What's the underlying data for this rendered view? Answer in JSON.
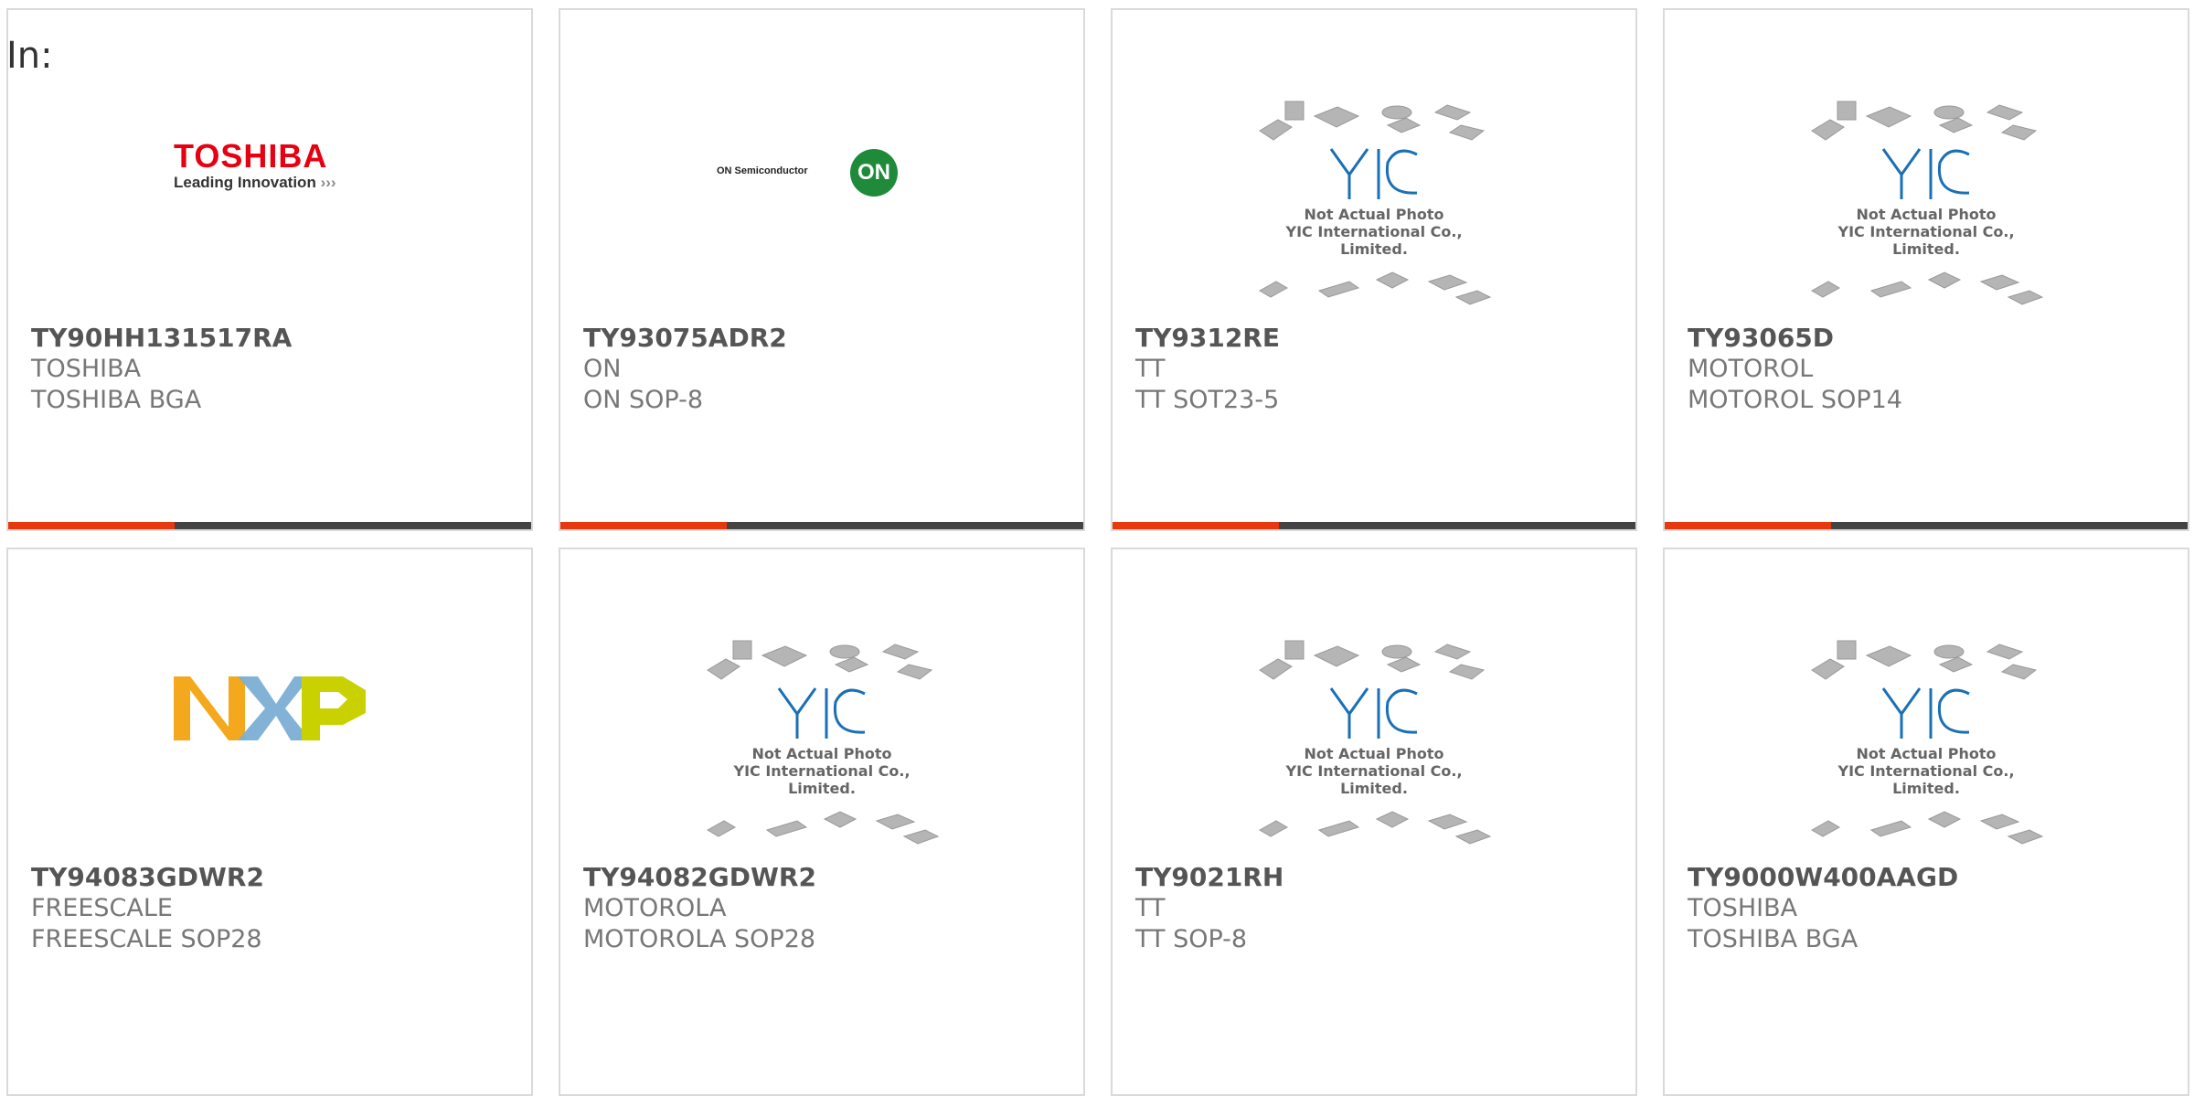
{
  "filter_label": "In:",
  "placeholder": {
    "line1": "Not Actual Photo",
    "line2": "YIC International Co., Limited."
  },
  "logos": {
    "toshiba": {
      "name": "TOSHIBA",
      "tagline": "Leading Innovation",
      "arrows": "›››"
    },
    "onsemi": {
      "name": "ON Semiconductor",
      "badge": "ON"
    },
    "nxp": {
      "name": "NXP"
    }
  },
  "colors": {
    "accent": "#e8380d",
    "bar": "#444444",
    "toshiba_red": "#e60012",
    "on_green": "#1f8a3a"
  },
  "products": [
    {
      "part": "TY90HH131517RA",
      "manufacturer": "TOSHIBA",
      "package": "TOSHIBA BGA",
      "image": "toshiba-logo"
    },
    {
      "part": "TY93075ADR2",
      "manufacturer": "ON",
      "package": "ON SOP-8",
      "image": "on-semiconductor-logo"
    },
    {
      "part": "TY9312RE",
      "manufacturer": "TT",
      "package": "TT SOT23-5",
      "image": "not-actual-photo"
    },
    {
      "part": "TY93065D",
      "manufacturer": "MOTOROL",
      "package": "MOTOROL SOP14",
      "image": "not-actual-photo"
    },
    {
      "part": "TY94083GDWR2",
      "manufacturer": "FREESCALE",
      "package": "FREESCALE SOP28",
      "image": "nxp-logo"
    },
    {
      "part": "TY94082GDWR2",
      "manufacturer": "MOTOROLA",
      "package": "MOTOROLA SOP28",
      "image": "not-actual-photo"
    },
    {
      "part": "TY9021RH",
      "manufacturer": "TT",
      "package": "TT SOP-8",
      "image": "not-actual-photo"
    },
    {
      "part": "TY9000W400AAGD",
      "manufacturer": "TOSHIBA",
      "package": "TOSHIBA BGA",
      "image": "not-actual-photo"
    }
  ]
}
